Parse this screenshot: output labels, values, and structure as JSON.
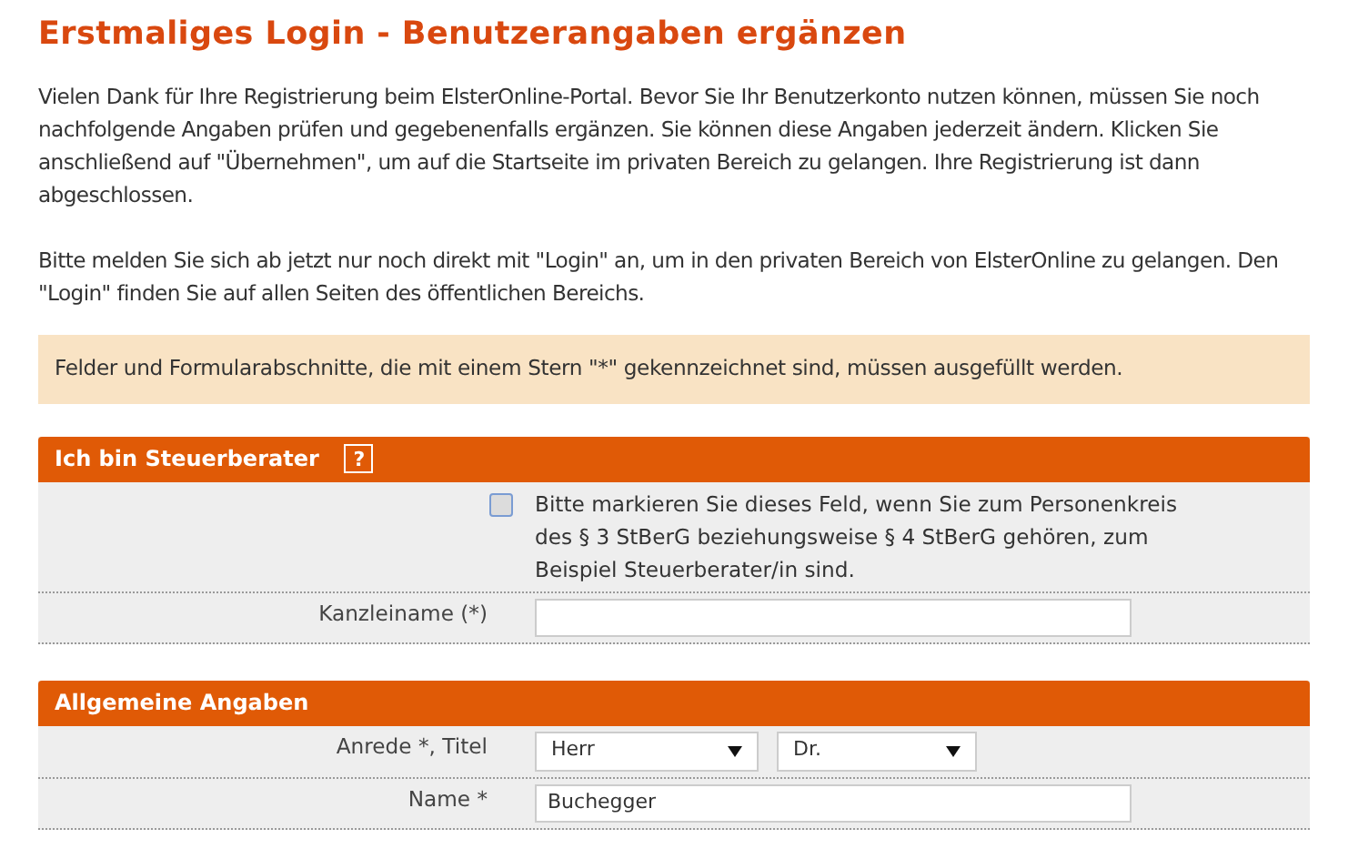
{
  "title": "Erstmaliges Login - Benutzerangaben ergänzen",
  "paragraphs": [
    "Vielen Dank für Ihre Registrierung beim ElsterOnline-Portal. Bevor Sie Ihr Benutzerkonto nutzen können, müssen Sie noch nachfolgende Angaben prüfen und gegebenenfalls ergänzen. Sie können diese Angaben jederzeit ändern. Klicken Sie anschließend auf \"Übernehmen\", um auf die Startseite im privaten Bereich zu gelangen. Ihre Registrierung ist dann abgeschlossen.",
    "Bitte melden Sie sich ab jetzt nur noch direkt mit \"Login\" an, um in den privaten Bereich von ElsterOnline zu gelangen. Den \"Login\" finden Sie auf allen Seiten des öffentlichen Bereichs."
  ],
  "notice": "Felder und Formularabschnitte, die mit einem Stern \"*\" gekennzeichnet sind, müssen ausgefüllt werden.",
  "sections": [
    {
      "title": "Ich bin Steuerberater",
      "help": "?",
      "rows": [
        {
          "kind": "checkbox",
          "checked": false,
          "text": "Bitte markieren Sie dieses Feld, wenn Sie zum Personenkreis des § 3 StBerG beziehungsweise § 4 StBerG gehören, zum Beispiel Steuerberater/in sind."
        },
        {
          "kind": "text",
          "label": "Kanzleiname (*)"
        }
      ]
    },
    {
      "title": "Allgemeine Angaben",
      "rows": [
        {
          "kind": "selects",
          "label": "Anrede *, Titel",
          "values": [
            "Herr",
            "Dr."
          ]
        },
        {
          "kind": "text",
          "label": "Name *",
          "value": "Buchegger"
        }
      ]
    }
  ]
}
